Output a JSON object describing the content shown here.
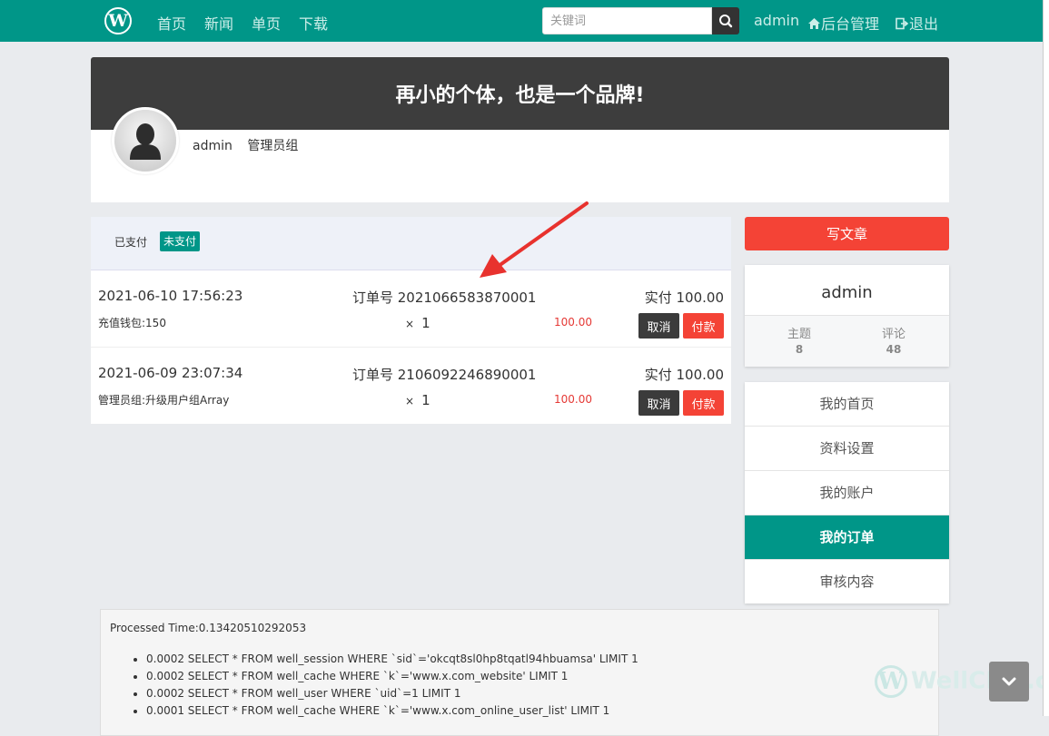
{
  "nav": {
    "logo": "W",
    "links": [
      "首页",
      "新闻",
      "单页",
      "下载"
    ],
    "search_placeholder": "关键词",
    "user": "admin",
    "admin_label": "后台管理",
    "logout_label": "退出"
  },
  "banner": {
    "slogan": "再小的个体，也是一个品牌!",
    "username": "admin",
    "group": "管理员组"
  },
  "orders": {
    "tabs": {
      "paid": "已支付",
      "unpaid": "未支付"
    },
    "cancel_label": "取消",
    "pay_label": "付款",
    "list": [
      {
        "date": "2021-06-10 17:56:23",
        "order_no": "订单号 2021066583870001",
        "paid": "实付 100.00",
        "item": "充值钱包:150",
        "qty_x": "×",
        "qty": "1",
        "price": "100.00"
      },
      {
        "date": "2021-06-09 23:07:34",
        "order_no": "订单号 2106092246890001",
        "paid": "实付 100.00",
        "item": "管理员组:升级用户组Array",
        "qty_x": "×",
        "qty": "1",
        "price": "100.00"
      }
    ]
  },
  "sidebar": {
    "write_label": "写文章",
    "profile": {
      "name": "admin",
      "stats": [
        {
          "label": "主题",
          "value": "8"
        },
        {
          "label": "评论",
          "value": "48"
        }
      ]
    },
    "menu": [
      "我的首页",
      "资料设置",
      "我的账户",
      "我的订单",
      "审核内容"
    ],
    "active_menu": "我的订单"
  },
  "debug": {
    "processed_time": "Processed Time:0.13420510292053",
    "queries": [
      "0.0002 SELECT * FROM well_session WHERE `sid`='okcqt8sl0hp8tqatl94hbuamsa' LIMIT 1",
      "0.0002 SELECT * FROM well_cache WHERE `k`='www.x.com_website' LIMIT 1",
      "0.0002 SELECT * FROM well_user WHERE `uid`=1 LIMIT 1",
      "0.0001 SELECT * FROM well_cache WHERE `k`='www.x.com_online_user_list' LIMIT 1"
    ]
  },
  "watermark": "WellCMS.cn",
  "colors": {
    "primary": "#009688",
    "danger": "#f44336",
    "dark": "#3d3d3d",
    "price": "#e53935"
  }
}
